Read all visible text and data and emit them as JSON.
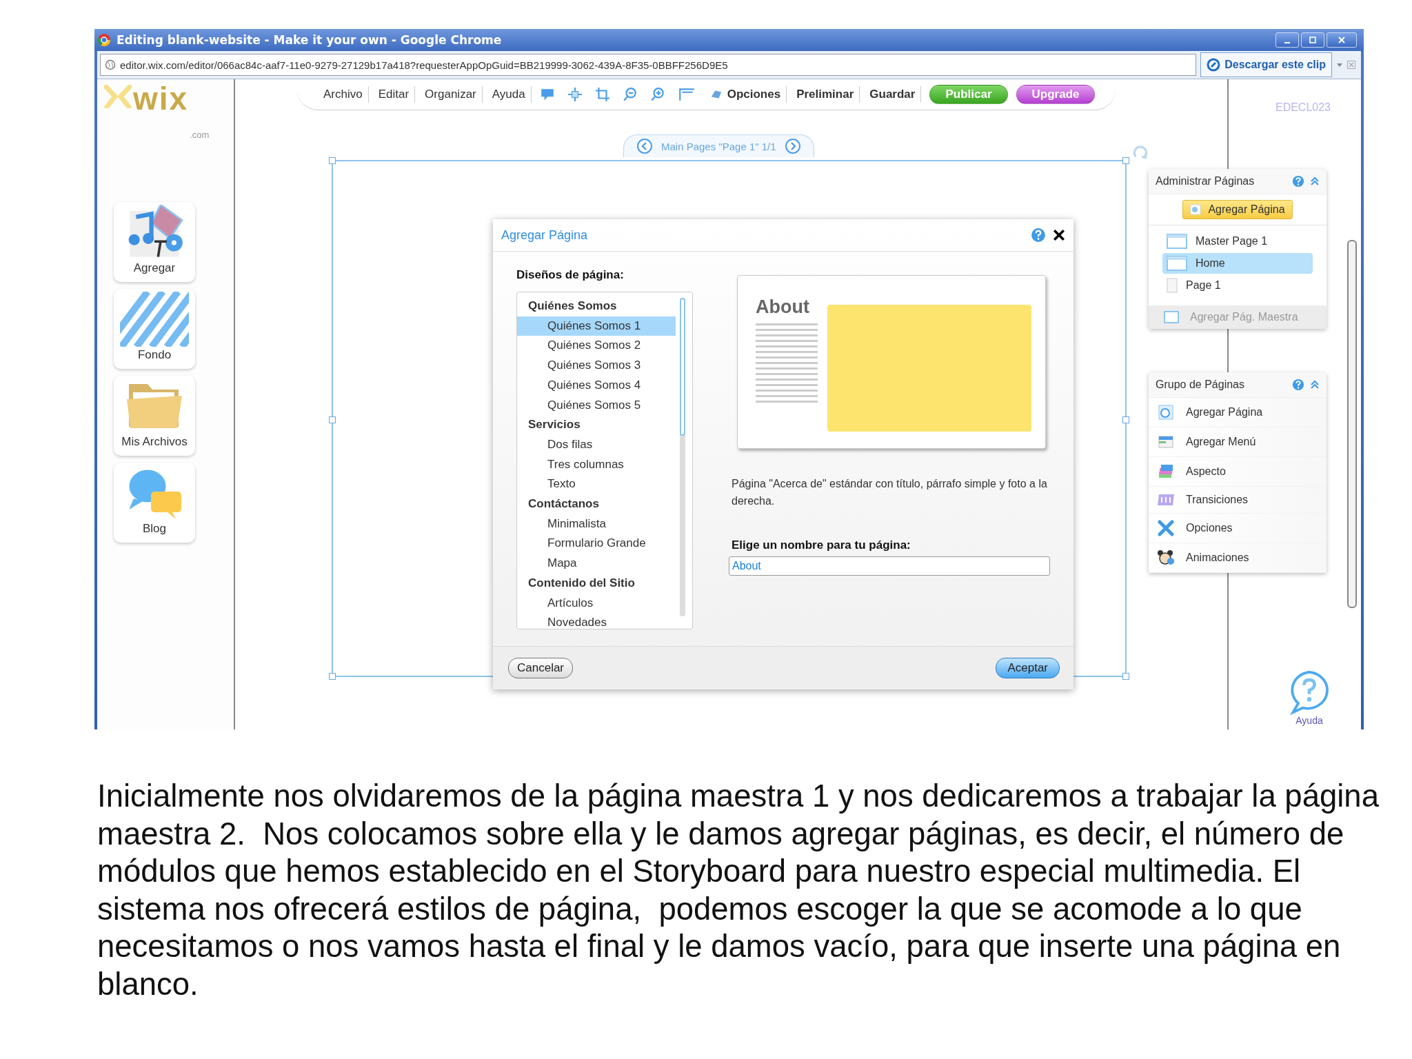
{
  "window": {
    "title": "Editing blank-website - Make it your own - Google Chrome"
  },
  "address_bar": {
    "url": "editor.wix.com/editor/066ac84c-aaf7-11e0-9279-27129b17a418?requesterAppOpGuid=BB219999-3062-439A-8F35-0BBFF256D9E5",
    "clip_button": "Descargar este clip"
  },
  "logo": {
    "text": "wix",
    "suffix": ".com"
  },
  "toolbar": {
    "menus": [
      "Archivo",
      "Editar",
      "Organizar",
      "Ayuda"
    ],
    "options": "Opciones",
    "preview": "Preliminar",
    "save": "Guardar",
    "publish": "Publicar",
    "upgrade": "Upgrade"
  },
  "user_label": "EDECL023",
  "sidebar": {
    "items": [
      {
        "label": "Agregar",
        "kind": "add"
      },
      {
        "label": "Fondo",
        "kind": "background"
      },
      {
        "label": "Mis Archivos",
        "kind": "files"
      },
      {
        "label": "Blog",
        "kind": "blog"
      }
    ]
  },
  "page_nav": {
    "label": "Main Pages \"Page 1\" 1/1"
  },
  "dialog": {
    "title": "Agregar Página",
    "layouts_label": "Diseños de página:",
    "sections": [
      {
        "name": "Quiénes Somos",
        "items": [
          {
            "label": "Quiénes Somos 1",
            "selected": true
          },
          {
            "label": "Quiénes Somos 2",
            "selected": false
          },
          {
            "label": "Quiénes Somos 3",
            "selected": false
          },
          {
            "label": "Quiénes Somos 4",
            "selected": false
          },
          {
            "label": "Quiénes Somos 5",
            "selected": false
          }
        ]
      },
      {
        "name": "Servicios",
        "items": [
          {
            "label": "Dos filas",
            "selected": false
          },
          {
            "label": "Tres columnas",
            "selected": false
          },
          {
            "label": "Texto",
            "selected": false
          }
        ]
      },
      {
        "name": "Contáctanos",
        "items": [
          {
            "label": "Minimalista",
            "selected": false
          },
          {
            "label": "Formulario Grande",
            "selected": false
          },
          {
            "label": "Mapa",
            "selected": false
          }
        ]
      },
      {
        "name": "Contenido del Sitio",
        "items": [
          {
            "label": "Artículos",
            "selected": false
          },
          {
            "label": "Novedades",
            "selected": false
          }
        ]
      }
    ],
    "preview_title": "About",
    "description": "Página \"Acerca de\" estándar con título, párrafo simple y foto a la derecha.",
    "name_label": "Elige un nombre para tu página:",
    "name_value": "About",
    "cancel": "Cancelar",
    "accept": "Aceptar"
  },
  "pages_panel": {
    "title": "Administrar Páginas",
    "add_button": "Agregar Página",
    "pages": [
      {
        "label": "Master Page 1",
        "kind": "master",
        "selected": false
      },
      {
        "label": "Home",
        "kind": "master",
        "selected": true
      },
      {
        "label": "Page 1",
        "kind": "page",
        "selected": false
      }
    ],
    "add_master": "Agregar Pág. Maestra"
  },
  "group_panel": {
    "title": "Grupo de Páginas",
    "items": [
      {
        "label": "Agregar Página",
        "kind": "add-page"
      },
      {
        "label": "Agregar Menú",
        "kind": "menu"
      },
      {
        "label": "Aspecto",
        "kind": "look"
      },
      {
        "label": "Transiciones",
        "kind": "transitions"
      },
      {
        "label": "Opciones",
        "kind": "options"
      },
      {
        "label": "Animaciones",
        "kind": "animations"
      }
    ]
  },
  "help": {
    "label": "Ayuda"
  },
  "caption": "Inicialmente nos olvidaremos de la página maestra 1 y nos dedicaremos a trabajar la página maestra 2.  Nos colocamos sobre ella y le damos agregar páginas, es decir, el número de módulos que hemos establecido en el Storyboard para nuestro especial multimedia. El sistema nos ofrecerá estilos de página,  podemos escoger la que se acomode a lo que necesitamos o nos vamos hasta el final y le damos vacío, para que inserte una página en blanco."
}
